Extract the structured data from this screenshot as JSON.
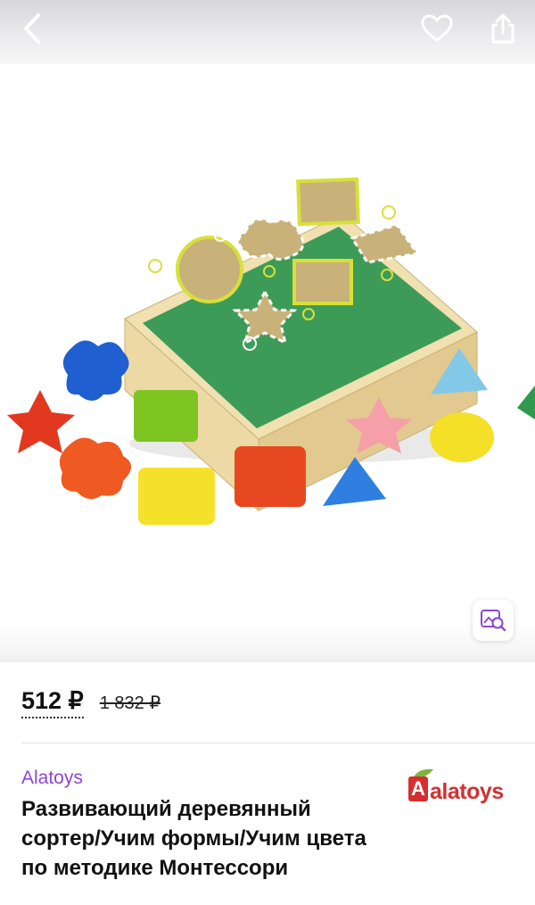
{
  "header": {
    "back_icon": "chevron-left-icon",
    "favorite_icon": "heart-outline-icon",
    "share_icon": "share-icon"
  },
  "gallery": {
    "image_alt": "",
    "visual_search_icon": "image-search-icon"
  },
  "price": {
    "current": "512 ₽",
    "old": "1 832 ₽"
  },
  "product": {
    "brand": "Alatoys",
    "title": "Развивающий деревянный сортер/Учим формы/Учим цвета по методике Монтессори",
    "brand_logo_text": "alatoys",
    "brand_logo_initial": "A"
  },
  "colors": {
    "accent": "#8d45d6",
    "brand_red": "#d62f2f",
    "box_green": "#3d9b58"
  }
}
